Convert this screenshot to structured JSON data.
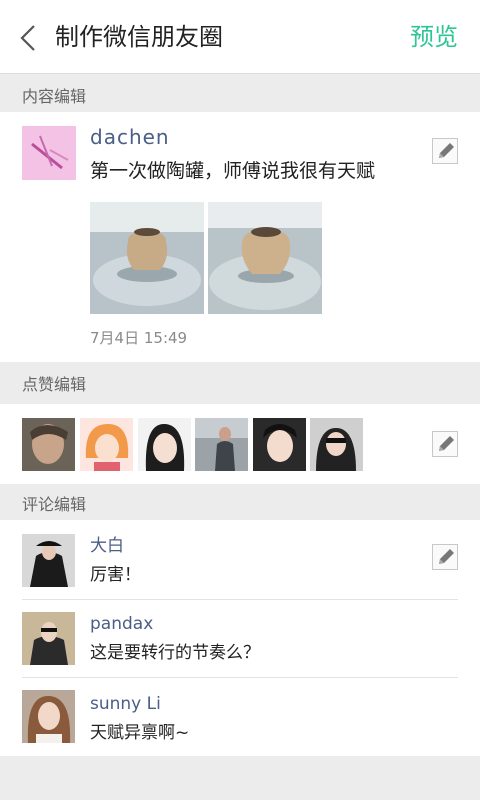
{
  "header": {
    "title": "制作微信朋友圈",
    "preview_label": "预览"
  },
  "sections": {
    "content_label": "内容编辑",
    "likes_label": "点赞编辑",
    "comments_label": "评论编辑"
  },
  "post": {
    "name": "dachen",
    "text": "第一次做陶罐，师傅说我很有天赋",
    "time": "7月4日 15:49",
    "photo_count": 2
  },
  "likes": {
    "count": 6
  },
  "comments": [
    {
      "name": "大白",
      "text": "厉害！"
    },
    {
      "name": "pandax",
      "text": "这是要转行的节奏么？"
    },
    {
      "name": "sunny Li",
      "text": "天赋异禀啊~"
    }
  ],
  "colors": {
    "accent": "#2fc496",
    "name_link": "#4a5e86",
    "section_bg": "#ececec"
  },
  "icons": {
    "back": "chevron-left-icon",
    "edit": "pencil-icon"
  }
}
